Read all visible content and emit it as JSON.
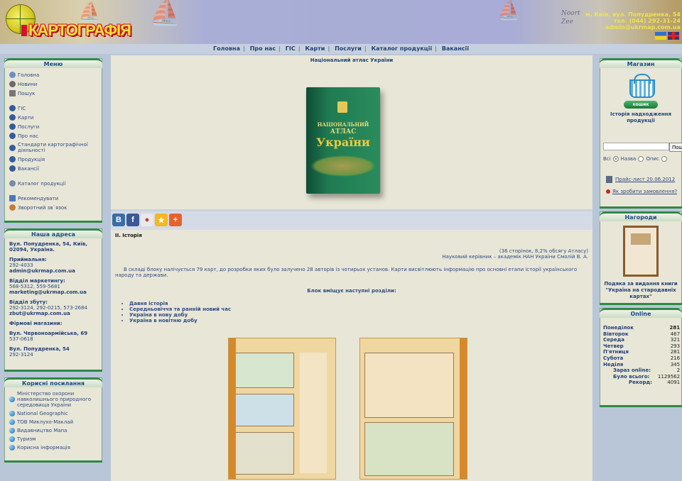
{
  "banner": {
    "logo": "КАРТОГРАФІЯ",
    "contact": [
      "м. Київ, вул. Попудренка, 54",
      "тел. (044) 292-31-24",
      "admin@ukrmap.com.ua"
    ],
    "map_text": [
      "Noort",
      "Zee"
    ]
  },
  "nav": [
    "Головна",
    "Про нас",
    "ГІС",
    "Карти",
    "Послуги",
    "Каталог продукції",
    "Вакансії"
  ],
  "menu": {
    "title": "Меню",
    "items": [
      "Головна",
      "Новини",
      "Пошук",
      "ГІС",
      "Карти",
      "Послуги",
      "Про нас",
      "Стандарти картографічної діяльності",
      "Продукція",
      "Вакансії",
      "Каталог продукції",
      "Рекомендувати",
      "Зворотний зв`язок"
    ]
  },
  "address": {
    "title": "Наша адреса",
    "main_address": "Вул. Попудренка, 54, Київ, 02094, Україна.",
    "reception_label": "Приймальня:",
    "reception_phone": "292-4033",
    "reception_email": "admin@ukrmap.com.ua",
    "marketing_label": "Відділ маркетингу:",
    "marketing_phone": "568-5312, 559-5681",
    "marketing_email": "marketing@ukrmap.com.ua",
    "sales_label": "Відділ збуту:",
    "sales_phone": "292-3124, 292-0215, 573-2684",
    "sales_email": "zbut@ukrmap.com.ua",
    "shops_label": "Фірмові магазини:",
    "shop1": "Вул. Червоноармійська, 69",
    "shop1_phone": "537-0618",
    "shop2": "Вул. Попудренка, 54",
    "shop2_phone": "292-3124"
  },
  "links": {
    "title": "Корисні посилання",
    "items": [
      "Міністерство охорони навколишнього природного середовища України",
      "National Geographic",
      "ТОВ Миклухо-Маклай",
      "Видавництво Мапа",
      "Туризм",
      "Корисна інформація"
    ]
  },
  "feature": {
    "title": "Національний атлас України",
    "book_line1": "НАЦІОНАЛЬНИЙ",
    "book_line2": "АТЛАС",
    "book_line3": "України"
  },
  "article": {
    "heading": "ІІ. Історія",
    "pages": "(36 сторінок, 8,2% обсягу Атласу)",
    "supervisor": "Науковий керівник – академік НАН України Смолій В. А.",
    "intro": "В складі блоку налічується 79 карт, до розробки яких було залучено 28 авторів із чотирьох установ. Карти висвітлюють інформацію про основні етапи історії українського народу та держави.",
    "sections_title": "Блок вміщує наступні розділи:",
    "sections": [
      "Давня історія",
      "Середньовіччя та ранній новий час",
      "Україна в нову добу",
      "Україна в новітню добу"
    ]
  },
  "shop": {
    "title": "Магазин",
    "cart_button": "кошик",
    "history": "Історія надходження продукції",
    "search_placeholder": "",
    "search_button": "Пошук",
    "radio_all": "Всі",
    "radio_name": "Назва",
    "radio_desc": "Опис",
    "price_list": "Прайс-лист 20.06.2012",
    "how_to_order": "Як зробити замовлення?"
  },
  "awards": {
    "title": "Нагороди",
    "caption": "Подяка за видання книги \"Україна на стародавніх картах\""
  },
  "online": {
    "title": "Online",
    "days": [
      {
        "day": "Понеділок",
        "value": "281"
      },
      {
        "day": "Вівторок",
        "value": "467"
      },
      {
        "day": "Середа",
        "value": "321"
      },
      {
        "day": "Четвер",
        "value": "293"
      },
      {
        "day": "П'ятниця",
        "value": "281"
      },
      {
        "day": "Субота",
        "value": "216"
      },
      {
        "day": "Неділя",
        "value": "345"
      }
    ],
    "now_label": "Зараз online:",
    "now": "2",
    "total_label": "Було всього:",
    "total": "1129562",
    "record_label": "Рекорд:",
    "record": "4091"
  }
}
